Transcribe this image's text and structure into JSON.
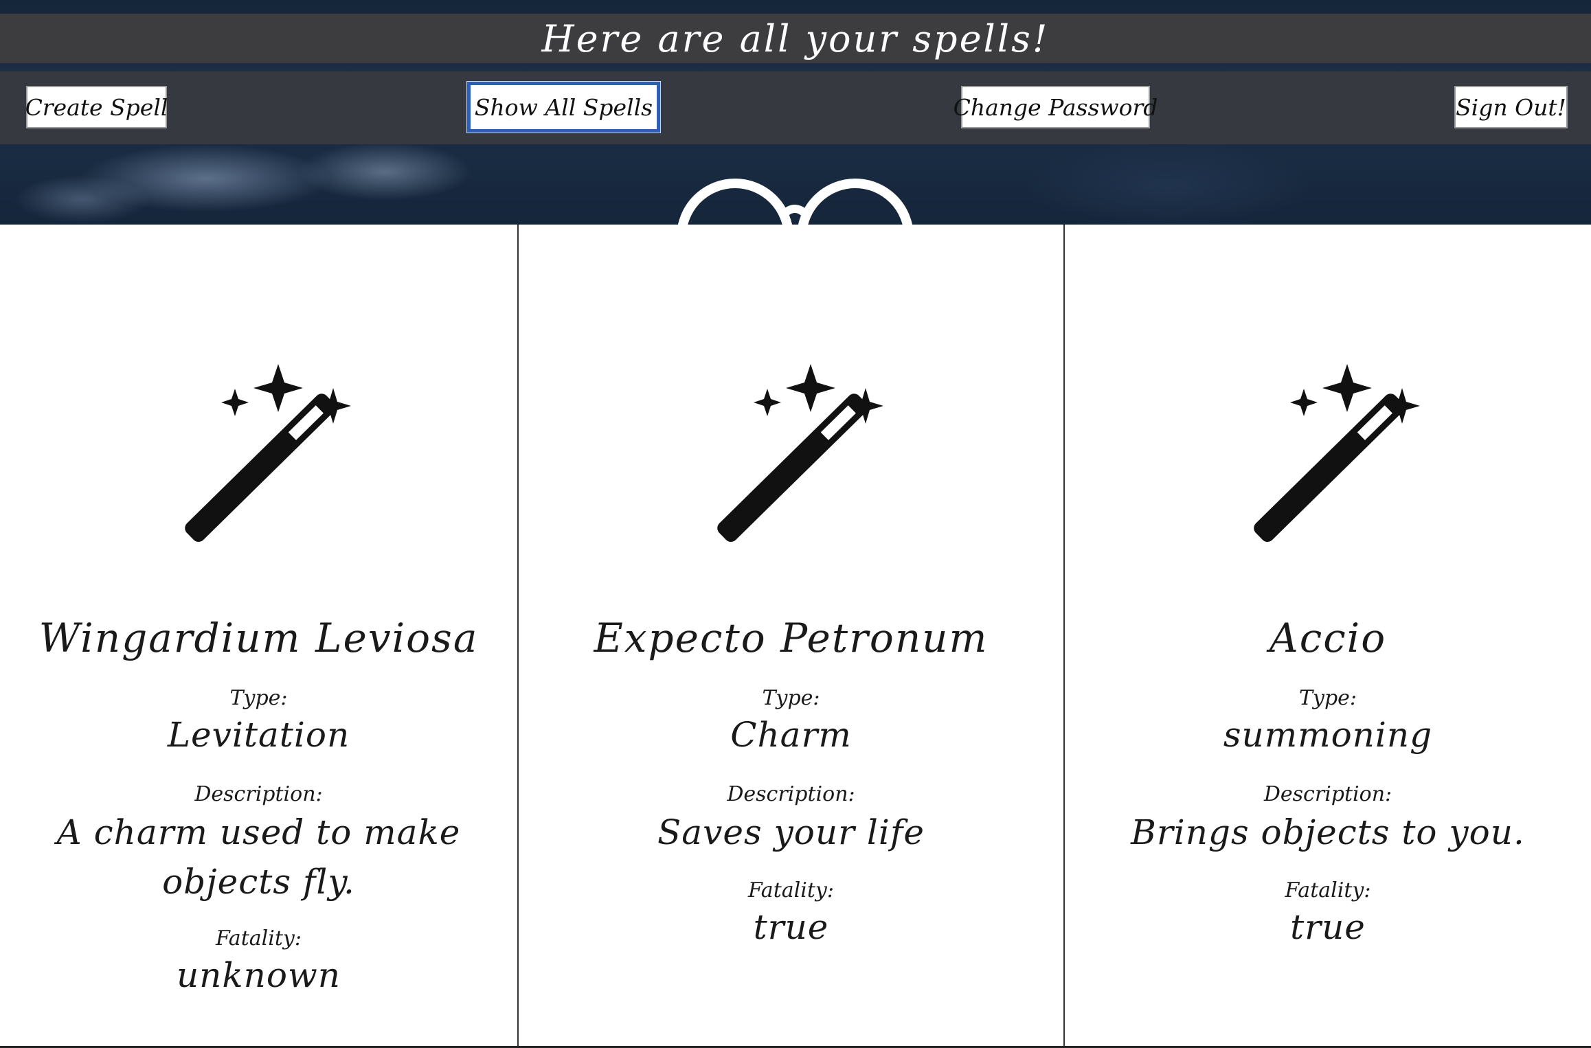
{
  "header": {
    "title": "Here are all your spells!"
  },
  "nav": {
    "create_spell": "Create Spell",
    "show_all_spells": "Show All Spells",
    "change_password": "Change Password",
    "sign_out": "Sign Out!"
  },
  "labels": {
    "type": "Type:",
    "description": "Description:",
    "fatality": "Fatality:"
  },
  "spells": [
    {
      "name": "Wingardium Leviosa",
      "type": "Levitation",
      "description": "A charm used to make objects fly.",
      "fatality": "unknown"
    },
    {
      "name": "Expecto Petronum",
      "type": "Charm",
      "description": "Saves your life",
      "fatality": "true"
    },
    {
      "name": "Accio",
      "type": "summoning",
      "description": "Brings objects to you.",
      "fatality": "true"
    }
  ],
  "colors": {
    "title_bar": "#3d3d3f",
    "nav_bar": "#363a40",
    "active_outline": "#2f5fb3",
    "card_bg": "#ffffff"
  },
  "icons": {
    "spell_card": "magic-wand-icon",
    "hero_decoration": "round-glasses-icon"
  }
}
